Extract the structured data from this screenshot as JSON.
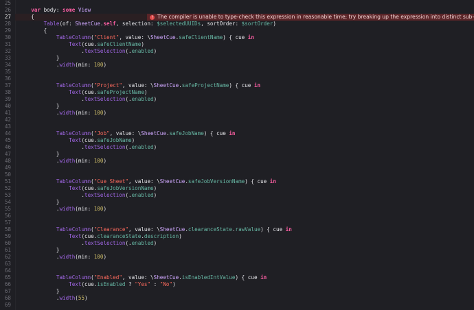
{
  "error": {
    "icon": "error-icon",
    "icon_glyph": "!",
    "message": "The compiler is unable to type-check this expression in reasonable time; try breaking up the expression into distinct sub-expressions",
    "line_index": 2,
    "color": "#5a2528"
  },
  "lines": [
    {
      "n": "25",
      "tokens": []
    },
    {
      "n": "26",
      "tokens": [
        {
          "t": "    "
        },
        {
          "k": "kw",
          "t": "var"
        },
        {
          "t": " body: "
        },
        {
          "k": "kw",
          "t": "some"
        },
        {
          "t": " "
        },
        {
          "k": "type",
          "t": "View"
        }
      ]
    },
    {
      "n": "27",
      "current": true,
      "tokens": [
        {
          "t": "    {"
        }
      ]
    },
    {
      "n": "28",
      "tokens": [
        {
          "t": "        "
        },
        {
          "k": "func",
          "t": "Table"
        },
        {
          "t": "(of: "
        },
        {
          "k": "type",
          "t": "SheetCue"
        },
        {
          "t": "."
        },
        {
          "k": "kw",
          "t": "self"
        },
        {
          "t": ", selection: "
        },
        {
          "k": "member",
          "t": "$selectedUUIDs"
        },
        {
          "t": ", sortOrder: "
        },
        {
          "k": "member",
          "t": "$sortOrder"
        },
        {
          "t": ")"
        }
      ]
    },
    {
      "n": "29",
      "tokens": [
        {
          "t": "        {"
        }
      ]
    },
    {
      "n": "30",
      "tokens": [
        {
          "t": "            "
        },
        {
          "k": "func",
          "t": "TableColumn"
        },
        {
          "t": "("
        },
        {
          "k": "str",
          "t": "\"Client\""
        },
        {
          "t": ", value: \\"
        },
        {
          "k": "type",
          "t": "SheetCue"
        },
        {
          "t": "."
        },
        {
          "k": "member",
          "t": "safeClientName"
        },
        {
          "t": ") { cue "
        },
        {
          "k": "kw",
          "t": "in"
        }
      ]
    },
    {
      "n": "31",
      "tokens": [
        {
          "t": "                "
        },
        {
          "k": "func",
          "t": "Text"
        },
        {
          "t": "(cue."
        },
        {
          "k": "member",
          "t": "safeClientName"
        },
        {
          "t": ")"
        }
      ]
    },
    {
      "n": "32",
      "tokens": [
        {
          "t": "                    ."
        },
        {
          "k": "func",
          "t": "textSelection"
        },
        {
          "t": "(."
        },
        {
          "k": "member",
          "t": "enabled"
        },
        {
          "t": ")"
        }
      ]
    },
    {
      "n": "33",
      "tokens": [
        {
          "t": "            }"
        }
      ]
    },
    {
      "n": "34",
      "tokens": [
        {
          "t": "            ."
        },
        {
          "k": "func",
          "t": "width"
        },
        {
          "t": "(min: "
        },
        {
          "k": "num",
          "t": "100"
        },
        {
          "t": ")"
        }
      ]
    },
    {
      "n": "35",
      "tokens": []
    },
    {
      "n": "36",
      "tokens": []
    },
    {
      "n": "37",
      "tokens": [
        {
          "t": "            "
        },
        {
          "k": "func",
          "t": "TableColumn"
        },
        {
          "t": "("
        },
        {
          "k": "str",
          "t": "\"Project\""
        },
        {
          "t": ", value: \\"
        },
        {
          "k": "type",
          "t": "SheetCue"
        },
        {
          "t": "."
        },
        {
          "k": "member",
          "t": "safeProjectName"
        },
        {
          "t": ") { cue "
        },
        {
          "k": "kw",
          "t": "in"
        }
      ]
    },
    {
      "n": "38",
      "tokens": [
        {
          "t": "                "
        },
        {
          "k": "func",
          "t": "Text"
        },
        {
          "t": "(cue."
        },
        {
          "k": "member",
          "t": "safeProjectName"
        },
        {
          "t": ")"
        }
      ]
    },
    {
      "n": "39",
      "tokens": [
        {
          "t": "                    ."
        },
        {
          "k": "func",
          "t": "textSelection"
        },
        {
          "t": "(."
        },
        {
          "k": "member",
          "t": "enabled"
        },
        {
          "t": ")"
        }
      ]
    },
    {
      "n": "40",
      "tokens": [
        {
          "t": "            }"
        }
      ]
    },
    {
      "n": "41",
      "tokens": [
        {
          "t": "            ."
        },
        {
          "k": "func",
          "t": "width"
        },
        {
          "t": "(min: "
        },
        {
          "k": "num",
          "t": "100"
        },
        {
          "t": ")"
        }
      ]
    },
    {
      "n": "42",
      "tokens": []
    },
    {
      "n": "43",
      "tokens": []
    },
    {
      "n": "44",
      "tokens": [
        {
          "t": "            "
        },
        {
          "k": "func",
          "t": "TableColumn"
        },
        {
          "t": "("
        },
        {
          "k": "str",
          "t": "\"Job\""
        },
        {
          "t": ", value: \\"
        },
        {
          "k": "type",
          "t": "SheetCue"
        },
        {
          "t": "."
        },
        {
          "k": "member",
          "t": "safeJobName"
        },
        {
          "t": ") { cue "
        },
        {
          "k": "kw",
          "t": "in"
        }
      ]
    },
    {
      "n": "45",
      "tokens": [
        {
          "t": "                "
        },
        {
          "k": "func",
          "t": "Text"
        },
        {
          "t": "(cue."
        },
        {
          "k": "member",
          "t": "safeJobName"
        },
        {
          "t": ")"
        }
      ]
    },
    {
      "n": "46",
      "tokens": [
        {
          "t": "                    ."
        },
        {
          "k": "func",
          "t": "textSelection"
        },
        {
          "t": "(."
        },
        {
          "k": "member",
          "t": "enabled"
        },
        {
          "t": ")"
        }
      ]
    },
    {
      "n": "47",
      "tokens": [
        {
          "t": "            }"
        }
      ]
    },
    {
      "n": "48",
      "tokens": [
        {
          "t": "            ."
        },
        {
          "k": "func",
          "t": "width"
        },
        {
          "t": "(min: "
        },
        {
          "k": "num",
          "t": "100"
        },
        {
          "t": ")"
        }
      ]
    },
    {
      "n": "49",
      "tokens": []
    },
    {
      "n": "50",
      "tokens": []
    },
    {
      "n": "51",
      "tokens": [
        {
          "t": "            "
        },
        {
          "k": "func",
          "t": "TableColumn"
        },
        {
          "t": "("
        },
        {
          "k": "str",
          "t": "\"Cue Sheet\""
        },
        {
          "t": ", value: \\"
        },
        {
          "k": "type",
          "t": "SheetCue"
        },
        {
          "t": "."
        },
        {
          "k": "member",
          "t": "safeJobVersionName"
        },
        {
          "t": ") { cue "
        },
        {
          "k": "kw",
          "t": "in"
        }
      ]
    },
    {
      "n": "52",
      "tokens": [
        {
          "t": "                "
        },
        {
          "k": "func",
          "t": "Text"
        },
        {
          "t": "(cue."
        },
        {
          "k": "member",
          "t": "safeJobVersionName"
        },
        {
          "t": ")"
        }
      ]
    },
    {
      "n": "53",
      "tokens": [
        {
          "t": "                    ."
        },
        {
          "k": "func",
          "t": "textSelection"
        },
        {
          "t": "(."
        },
        {
          "k": "member",
          "t": "enabled"
        },
        {
          "t": ")"
        }
      ]
    },
    {
      "n": "54",
      "tokens": [
        {
          "t": "            }"
        }
      ]
    },
    {
      "n": "55",
      "tokens": [
        {
          "t": "            ."
        },
        {
          "k": "func",
          "t": "width"
        },
        {
          "t": "(min: "
        },
        {
          "k": "num",
          "t": "100"
        },
        {
          "t": ")"
        }
      ]
    },
    {
      "n": "56",
      "tokens": []
    },
    {
      "n": "57",
      "tokens": []
    },
    {
      "n": "58",
      "tokens": [
        {
          "t": "            "
        },
        {
          "k": "func",
          "t": "TableColumn"
        },
        {
          "t": "("
        },
        {
          "k": "str",
          "t": "\"Clearance\""
        },
        {
          "t": ", value: \\"
        },
        {
          "k": "type",
          "t": "SheetCue"
        },
        {
          "t": "."
        },
        {
          "k": "member",
          "t": "clearanceState"
        },
        {
          "t": "."
        },
        {
          "k": "member",
          "t": "rawValue"
        },
        {
          "t": ") { cue "
        },
        {
          "k": "kw",
          "t": "in"
        }
      ]
    },
    {
      "n": "59",
      "tokens": [
        {
          "t": "                "
        },
        {
          "k": "func",
          "t": "Text"
        },
        {
          "t": "(cue."
        },
        {
          "k": "member",
          "t": "clearanceState"
        },
        {
          "t": "."
        },
        {
          "k": "member",
          "t": "description"
        },
        {
          "t": ")"
        }
      ]
    },
    {
      "n": "60",
      "tokens": [
        {
          "t": "                    ."
        },
        {
          "k": "func",
          "t": "textSelection"
        },
        {
          "t": "(."
        },
        {
          "k": "member",
          "t": "enabled"
        },
        {
          "t": ")"
        }
      ]
    },
    {
      "n": "61",
      "tokens": [
        {
          "t": "            }"
        }
      ]
    },
    {
      "n": "62",
      "tokens": [
        {
          "t": "            ."
        },
        {
          "k": "func",
          "t": "width"
        },
        {
          "t": "(min: "
        },
        {
          "k": "num",
          "t": "100"
        },
        {
          "t": ")"
        }
      ]
    },
    {
      "n": "63",
      "tokens": []
    },
    {
      "n": "64",
      "tokens": []
    },
    {
      "n": "65",
      "tokens": [
        {
          "t": "            "
        },
        {
          "k": "func",
          "t": "TableColumn"
        },
        {
          "t": "("
        },
        {
          "k": "str",
          "t": "\"Enabled\""
        },
        {
          "t": ", value: \\"
        },
        {
          "k": "type",
          "t": "SheetCue"
        },
        {
          "t": "."
        },
        {
          "k": "member",
          "t": "isEnabledIntValue"
        },
        {
          "t": ") { cue "
        },
        {
          "k": "kw",
          "t": "in"
        }
      ]
    },
    {
      "n": "66",
      "tokens": [
        {
          "t": "                "
        },
        {
          "k": "func",
          "t": "Text"
        },
        {
          "t": "(cue."
        },
        {
          "k": "member",
          "t": "isEnabled"
        },
        {
          "t": " ? "
        },
        {
          "k": "str",
          "t": "\"Yes\""
        },
        {
          "t": " : "
        },
        {
          "k": "str",
          "t": "\"No\""
        },
        {
          "t": ")"
        }
      ]
    },
    {
      "n": "67",
      "tokens": [
        {
          "t": "            }"
        }
      ]
    },
    {
      "n": "68",
      "tokens": [
        {
          "t": "            ."
        },
        {
          "k": "func",
          "t": "width"
        },
        {
          "t": "("
        },
        {
          "k": "num",
          "t": "55"
        },
        {
          "t": ")"
        }
      ]
    },
    {
      "n": "69",
      "tokens": []
    }
  ]
}
